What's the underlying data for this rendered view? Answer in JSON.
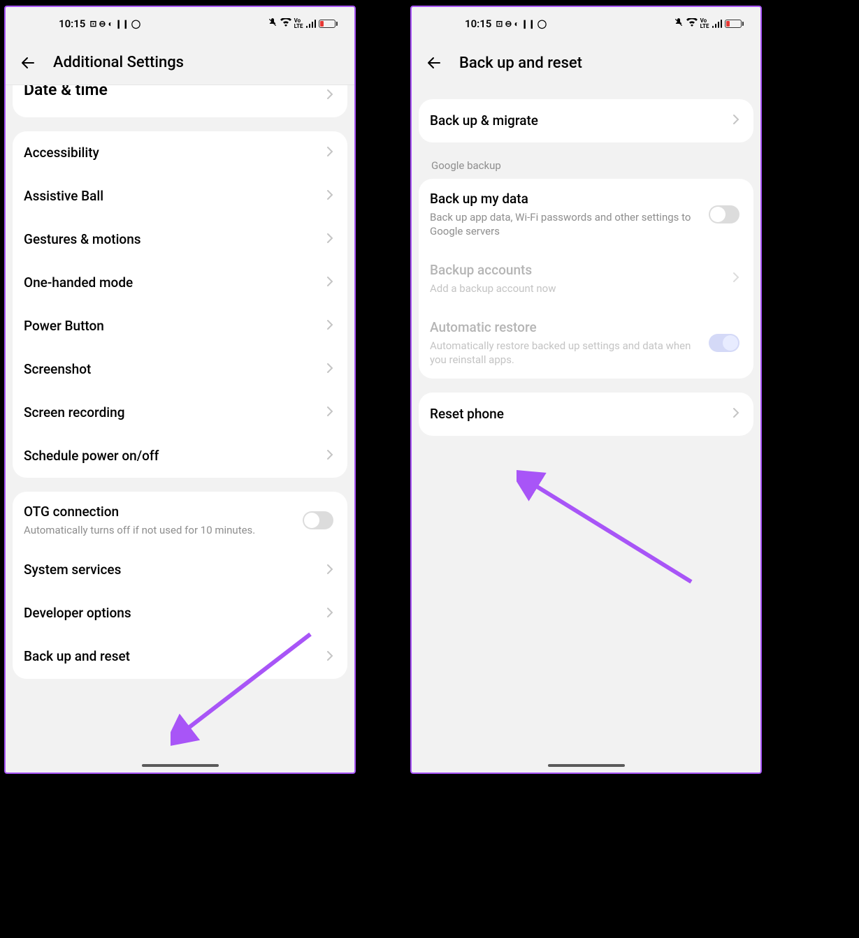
{
  "status": {
    "time": "10:15",
    "lte_label": "Vo LTE"
  },
  "left_screen": {
    "title": "Additional Settings",
    "partial_item": "Date & time",
    "group1": [
      "Accessibility",
      "Assistive Ball",
      "Gestures & motions",
      "One-handed mode",
      "Power Button",
      "Screenshot",
      "Screen recording",
      "Schedule power on/off"
    ],
    "otg": {
      "title": "OTG connection",
      "subtitle": "Automatically turns off if not used for 10 minutes."
    },
    "group2": [
      "System services",
      "Developer options",
      "Back up and reset"
    ]
  },
  "right_screen": {
    "title": "Back up and reset",
    "backup_migrate": "Back up & migrate",
    "google_section": "Google backup",
    "backup_data": {
      "title": "Back up my data",
      "subtitle": "Back up app data, Wi-Fi passwords and other settings to Google servers"
    },
    "backup_accounts": {
      "title": "Backup accounts",
      "subtitle": "Add a backup account now"
    },
    "auto_restore": {
      "title": "Automatic restore",
      "subtitle": "Automatically restore backed up settings and data when you reinstall apps."
    },
    "reset_phone": "Reset phone"
  }
}
